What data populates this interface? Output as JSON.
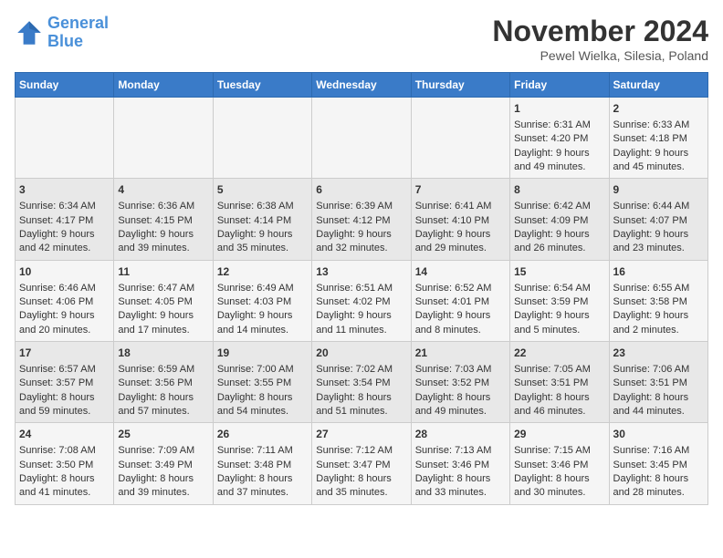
{
  "header": {
    "logo_line1": "General",
    "logo_line2": "Blue",
    "month": "November 2024",
    "location": "Pewel Wielka, Silesia, Poland"
  },
  "days_of_week": [
    "Sunday",
    "Monday",
    "Tuesday",
    "Wednesday",
    "Thursday",
    "Friday",
    "Saturday"
  ],
  "weeks": [
    [
      {
        "day": "",
        "info": ""
      },
      {
        "day": "",
        "info": ""
      },
      {
        "day": "",
        "info": ""
      },
      {
        "day": "",
        "info": ""
      },
      {
        "day": "",
        "info": ""
      },
      {
        "day": "1",
        "info": "Sunrise: 6:31 AM\nSunset: 4:20 PM\nDaylight: 9 hours and 49 minutes."
      },
      {
        "day": "2",
        "info": "Sunrise: 6:33 AM\nSunset: 4:18 PM\nDaylight: 9 hours and 45 minutes."
      }
    ],
    [
      {
        "day": "3",
        "info": "Sunrise: 6:34 AM\nSunset: 4:17 PM\nDaylight: 9 hours and 42 minutes."
      },
      {
        "day": "4",
        "info": "Sunrise: 6:36 AM\nSunset: 4:15 PM\nDaylight: 9 hours and 39 minutes."
      },
      {
        "day": "5",
        "info": "Sunrise: 6:38 AM\nSunset: 4:14 PM\nDaylight: 9 hours and 35 minutes."
      },
      {
        "day": "6",
        "info": "Sunrise: 6:39 AM\nSunset: 4:12 PM\nDaylight: 9 hours and 32 minutes."
      },
      {
        "day": "7",
        "info": "Sunrise: 6:41 AM\nSunset: 4:10 PM\nDaylight: 9 hours and 29 minutes."
      },
      {
        "day": "8",
        "info": "Sunrise: 6:42 AM\nSunset: 4:09 PM\nDaylight: 9 hours and 26 minutes."
      },
      {
        "day": "9",
        "info": "Sunrise: 6:44 AM\nSunset: 4:07 PM\nDaylight: 9 hours and 23 minutes."
      }
    ],
    [
      {
        "day": "10",
        "info": "Sunrise: 6:46 AM\nSunset: 4:06 PM\nDaylight: 9 hours and 20 minutes."
      },
      {
        "day": "11",
        "info": "Sunrise: 6:47 AM\nSunset: 4:05 PM\nDaylight: 9 hours and 17 minutes."
      },
      {
        "day": "12",
        "info": "Sunrise: 6:49 AM\nSunset: 4:03 PM\nDaylight: 9 hours and 14 minutes."
      },
      {
        "day": "13",
        "info": "Sunrise: 6:51 AM\nSunset: 4:02 PM\nDaylight: 9 hours and 11 minutes."
      },
      {
        "day": "14",
        "info": "Sunrise: 6:52 AM\nSunset: 4:01 PM\nDaylight: 9 hours and 8 minutes."
      },
      {
        "day": "15",
        "info": "Sunrise: 6:54 AM\nSunset: 3:59 PM\nDaylight: 9 hours and 5 minutes."
      },
      {
        "day": "16",
        "info": "Sunrise: 6:55 AM\nSunset: 3:58 PM\nDaylight: 9 hours and 2 minutes."
      }
    ],
    [
      {
        "day": "17",
        "info": "Sunrise: 6:57 AM\nSunset: 3:57 PM\nDaylight: 8 hours and 59 minutes."
      },
      {
        "day": "18",
        "info": "Sunrise: 6:59 AM\nSunset: 3:56 PM\nDaylight: 8 hours and 57 minutes."
      },
      {
        "day": "19",
        "info": "Sunrise: 7:00 AM\nSunset: 3:55 PM\nDaylight: 8 hours and 54 minutes."
      },
      {
        "day": "20",
        "info": "Sunrise: 7:02 AM\nSunset: 3:54 PM\nDaylight: 8 hours and 51 minutes."
      },
      {
        "day": "21",
        "info": "Sunrise: 7:03 AM\nSunset: 3:52 PM\nDaylight: 8 hours and 49 minutes."
      },
      {
        "day": "22",
        "info": "Sunrise: 7:05 AM\nSunset: 3:51 PM\nDaylight: 8 hours and 46 minutes."
      },
      {
        "day": "23",
        "info": "Sunrise: 7:06 AM\nSunset: 3:51 PM\nDaylight: 8 hours and 44 minutes."
      }
    ],
    [
      {
        "day": "24",
        "info": "Sunrise: 7:08 AM\nSunset: 3:50 PM\nDaylight: 8 hours and 41 minutes."
      },
      {
        "day": "25",
        "info": "Sunrise: 7:09 AM\nSunset: 3:49 PM\nDaylight: 8 hours and 39 minutes."
      },
      {
        "day": "26",
        "info": "Sunrise: 7:11 AM\nSunset: 3:48 PM\nDaylight: 8 hours and 37 minutes."
      },
      {
        "day": "27",
        "info": "Sunrise: 7:12 AM\nSunset: 3:47 PM\nDaylight: 8 hours and 35 minutes."
      },
      {
        "day": "28",
        "info": "Sunrise: 7:13 AM\nSunset: 3:46 PM\nDaylight: 8 hours and 33 minutes."
      },
      {
        "day": "29",
        "info": "Sunrise: 7:15 AM\nSunset: 3:46 PM\nDaylight: 8 hours and 30 minutes."
      },
      {
        "day": "30",
        "info": "Sunrise: 7:16 AM\nSunset: 3:45 PM\nDaylight: 8 hours and 28 minutes."
      }
    ]
  ]
}
